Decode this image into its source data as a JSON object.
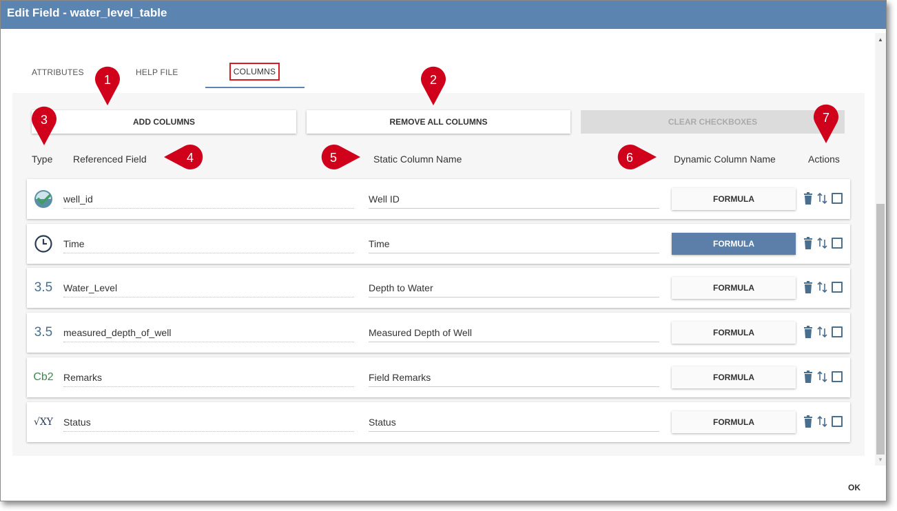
{
  "window": {
    "title": "Edit Field - water_level_table"
  },
  "tabs": {
    "attributes": "ATTRIBUTES",
    "help": "HELP FILE",
    "columns": "COLUMNS"
  },
  "toolbar": {
    "add": "ADD COLUMNS",
    "remove": "REMOVE ALL COLUMNS",
    "clear": "CLEAR CHECKBOXES"
  },
  "headers": {
    "type": "Type",
    "referenced": "Referenced Field",
    "static": "Static Column Name",
    "dynamic": "Dynamic Column Name",
    "actions": "Actions"
  },
  "rows": [
    {
      "type_icon": "well-id-icon",
      "referenced": "well_id",
      "static": "Well ID",
      "formula": "FORMULA"
    },
    {
      "type_icon": "clock-icon",
      "referenced": "Time",
      "static": "Time",
      "formula": "FORMULA"
    },
    {
      "type_icon": "number",
      "type_text": "3.5",
      "referenced": "Water_Level",
      "static": "Depth to Water",
      "formula": "FORMULA"
    },
    {
      "type_icon": "number",
      "type_text": "3.5",
      "referenced": "measured_depth_of_well",
      "static": "Measured Depth of Well",
      "formula": "FORMULA"
    },
    {
      "type_icon": "text",
      "type_text": "Cb2",
      "referenced": "Remarks",
      "static": "Field Remarks",
      "formula": "FORMULA"
    },
    {
      "type_icon": "formula",
      "type_text": "√XY",
      "referenced": "Status",
      "static": "Status",
      "formula": "FORMULA"
    }
  ],
  "callouts": [
    "1",
    "2",
    "3",
    "4",
    "5",
    "6",
    "7"
  ],
  "footer": {
    "ok": "OK"
  },
  "colors": {
    "title_bar": "#5b84b1",
    "callout": "#d0021b",
    "active_formula": "#5b7fa8"
  }
}
